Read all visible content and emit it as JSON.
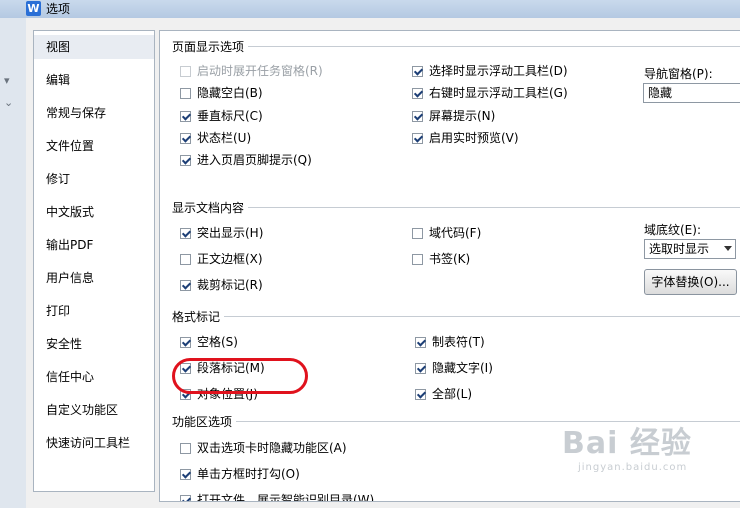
{
  "window": {
    "app_icon_letter": "W",
    "title": "选项"
  },
  "nav": {
    "items": [
      "视图",
      "编辑",
      "常规与保存",
      "文件位置",
      "修订",
      "中文版式",
      "输出PDF",
      "用户信息",
      "打印",
      "安全性",
      "信任中心",
      "自定义功能区",
      "快速访问工具栏"
    ],
    "selected": "视图"
  },
  "page_display": {
    "title": "页面显示选项",
    "options": [
      {
        "label": "启动时展开任务窗格(R)",
        "checked": false,
        "disabled": true
      },
      {
        "label": "隐藏空白(B)",
        "checked": false
      },
      {
        "label": "垂直标尺(C)",
        "checked": true
      },
      {
        "label": "状态栏(U)",
        "checked": true
      },
      {
        "label": "进入页眉页脚提示(Q)",
        "checked": true
      },
      {
        "label": "选择时显示浮动工具栏(D)",
        "checked": true
      },
      {
        "label": "右键时显示浮动工具栏(G)",
        "checked": true
      },
      {
        "label": "屏幕提示(N)",
        "checked": true
      },
      {
        "label": "启用实时预览(V)",
        "checked": true
      }
    ],
    "nav_pane_label": "导航窗格(P):",
    "nav_pane_value": "隐藏"
  },
  "doc_content": {
    "title": "显示文档内容",
    "options": [
      {
        "label": "突出显示(H)",
        "checked": true
      },
      {
        "label": "正文边框(X)",
        "checked": false
      },
      {
        "label": "裁剪标记(R)",
        "checked": true
      },
      {
        "label": "域代码(F)",
        "checked": false
      },
      {
        "label": "书签(K)",
        "checked": false
      }
    ],
    "field_shading_label": "域底纹(E):",
    "field_shading_value": "选取时显示",
    "font_substitute_button": "字体替换(O)..."
  },
  "format_marks": {
    "title": "格式标记",
    "options": [
      {
        "label": "空格(S)",
        "checked": true
      },
      {
        "label": "段落标记(M)",
        "checked": true
      },
      {
        "label": "对象位置(J)",
        "checked": true
      },
      {
        "label": "制表符(T)",
        "checked": true
      },
      {
        "label": "隐藏文字(I)",
        "checked": true
      },
      {
        "label": "全部(L)",
        "checked": true
      }
    ]
  },
  "ribbon": {
    "title": "功能区选项",
    "options": [
      {
        "label": "双击选项卡时隐藏功能区(A)",
        "checked": false
      },
      {
        "label": "单击方框时打勾(O)",
        "checked": true
      },
      {
        "label": "打开文件，展示智能识别目录(W)",
        "checked": true
      }
    ]
  },
  "watermark": {
    "main": "Bai 经验",
    "sub": "jingyan.baidu.com"
  }
}
